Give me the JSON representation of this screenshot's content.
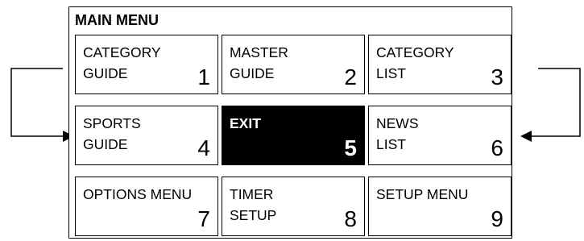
{
  "menu": {
    "title": "MAIN MENU",
    "items": [
      {
        "label": "CATEGORY\nGUIDE",
        "number": "1",
        "active": false
      },
      {
        "label": "MASTER\nGUIDE",
        "number": "2",
        "active": false
      },
      {
        "label": "CATEGORY\nLIST",
        "number": "3",
        "active": false
      },
      {
        "label": "SPORTS\nGUIDE",
        "number": "4",
        "active": false
      },
      {
        "label": "EXIT",
        "number": "5",
        "active": true
      },
      {
        "label": "NEWS\nLIST",
        "number": "6",
        "active": false
      },
      {
        "label": "OPTIONS MENU",
        "number": "7",
        "active": false
      },
      {
        "label": "TIMER\nSETUP",
        "number": "8",
        "active": false
      },
      {
        "label": "SETUP MENU",
        "number": "9",
        "active": false
      }
    ]
  },
  "colors": {
    "active_bg": "#000000",
    "active_text": "#ffffff",
    "line": "#000000"
  }
}
